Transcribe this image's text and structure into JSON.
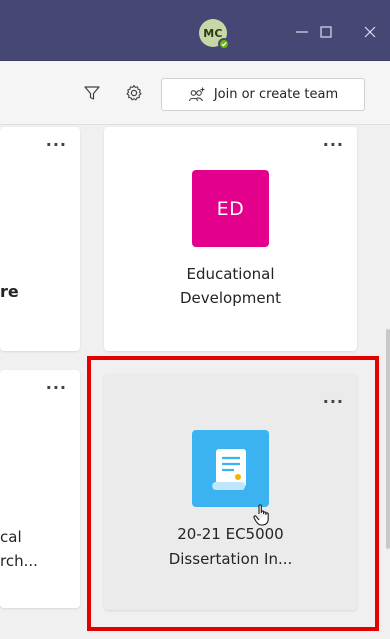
{
  "titlebar": {
    "avatar_initials": "MC",
    "presence": "available",
    "colors": {
      "bar": "#464775",
      "presence": "#6bb700"
    }
  },
  "toolbar": {
    "join_label": "Join or create team"
  },
  "cards": {
    "left_top": {
      "name_fragment": "re"
    },
    "right_top": {
      "initials": "ED",
      "tile_color": "#e3008c",
      "name_line1": "Educational",
      "name_line2": "Development",
      "menu": "..."
    },
    "left_bottom": {
      "name_line1": "cal",
      "name_line2": "rch...",
      "menu": "..."
    },
    "right_bottom": {
      "name_line1": "20-21 EC5000",
      "name_line2": "Dissertation In...",
      "tile_color": "#3bb3f0",
      "menu": "..."
    },
    "left_top_menu": "..."
  }
}
